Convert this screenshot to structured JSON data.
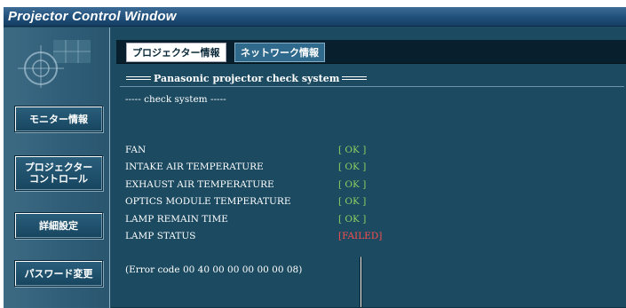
{
  "window": {
    "title": "Projector Control Window"
  },
  "sidebar": {
    "logo_icon": "projector-logo-icon",
    "items": [
      {
        "label": "モニター情報"
      },
      {
        "label": "プロジェクター\nコントロール"
      },
      {
        "label": "詳細設定"
      },
      {
        "label": "パスワード変更"
      }
    ]
  },
  "tabs": [
    {
      "label": "プロジェクター情報",
      "active": true
    },
    {
      "label": "ネットワーク情報",
      "active": false
    }
  ],
  "check": {
    "heading": "Panasonic projector check system",
    "subheading": "----- check system -----",
    "rows": [
      {
        "name": "FAN",
        "status": "[ OK ]"
      },
      {
        "name": "INTAKE AIR TEMPERATURE",
        "status": "[ OK ]"
      },
      {
        "name": "EXHAUST AIR TEMPERATURE",
        "status": "[ OK ]"
      },
      {
        "name": "OPTICS MODULE TEMPERATURE",
        "status": "[ OK ]"
      },
      {
        "name": "LAMP REMAIN TIME",
        "status": "[ OK ]"
      },
      {
        "name": "LAMP STATUS",
        "status": "[FAILED]"
      }
    ],
    "error_code": "(Error code 00 40 00 00 00 00 00 08)"
  },
  "colors": {
    "ok": "#8fcf63",
    "failed": "#ff4d4d",
    "background": "#1b4a61"
  }
}
